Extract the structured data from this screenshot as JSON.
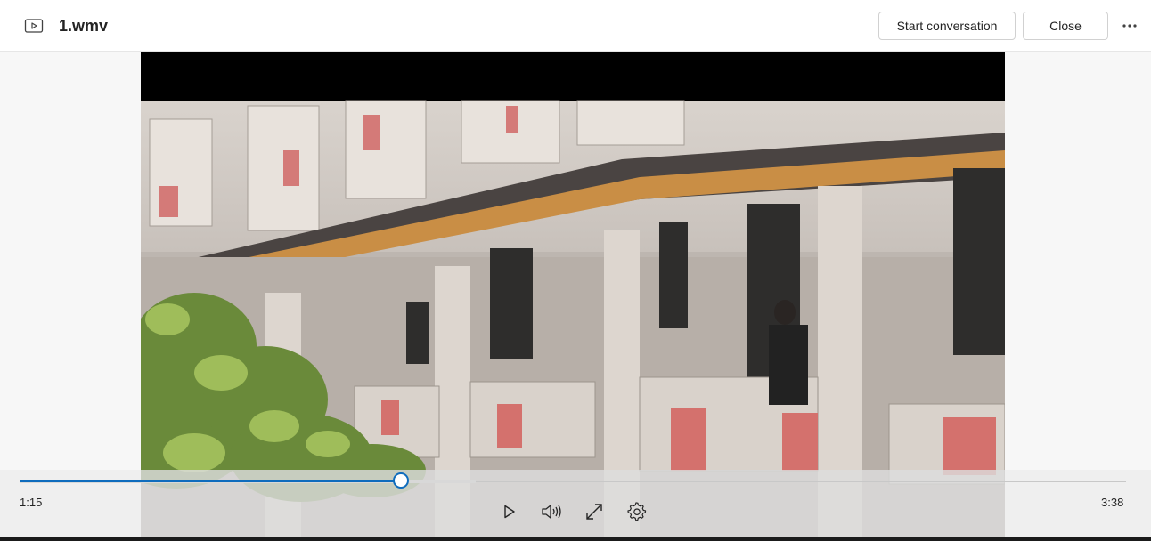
{
  "header": {
    "title": "1.wmv",
    "file_icon": "video-file-icon",
    "start_conversation_label": "Start conversation",
    "close_label": "Close",
    "more_icon": "more-options-icon"
  },
  "player": {
    "current_time": "1:15",
    "duration": "3:38",
    "progress_fraction": 0.345,
    "buffered_fraction": 0.412,
    "accent_color": "#0f6cbd",
    "controls": [
      "play-icon",
      "volume-icon",
      "fullscreen-icon",
      "settings-icon"
    ]
  }
}
